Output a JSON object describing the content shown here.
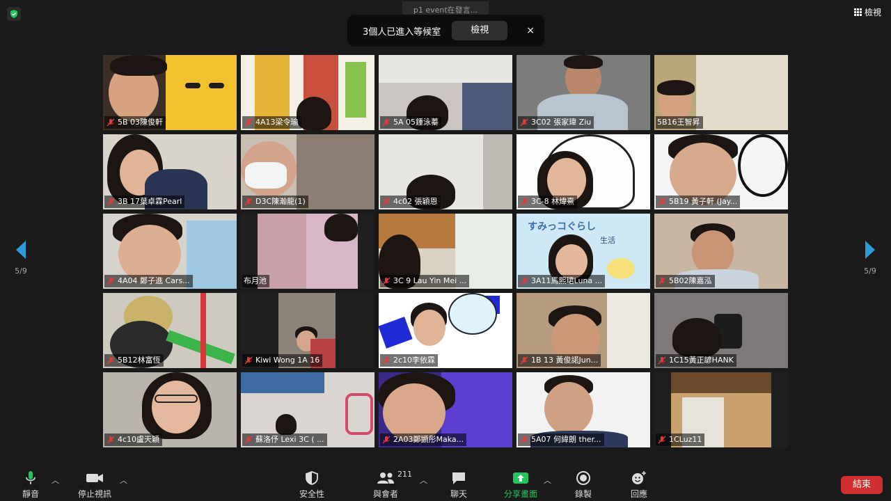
{
  "top": {
    "speaking_label": "p1 event在發言...",
    "view_label": "檢視"
  },
  "waiting_room": {
    "message": "3個人已進入等候室",
    "view_button": "檢視",
    "close_glyph": "×"
  },
  "pager": {
    "left_page": "5/9",
    "right_page": "5/9"
  },
  "participants": [
    "5B 03陳俊軒",
    "4A13梁令瑜",
    "5A 05鍾泳蓁",
    "3C02 張家瑋 Ziu",
    "5B16王智昇",
    "3B 17葉卓霖Pearl",
    "D3C陳瀚龍(1)",
    "4c02 張穎恩",
    "3C-8 林煒熹",
    "5B19 黃子軒 (Jay...",
    "4A04 鄭子進 Cars...",
    "布月池",
    "3C 9 Lau Yin Mei ...",
    "3A11馬熙珺Luna ...",
    "5B02陳嘉泓",
    "5B12林富恆",
    "Kiwi Wong 1A 16",
    "2c10李依霖",
    "1B  13  黃俊諾Jun...",
    "1C15黃正諺HANK",
    "4c10盧天穎",
    "蘇洛伃 Lexi  3C  ( ...",
    "2A03鄭顗彤Maka...",
    "5A07 何緯朗 ther...",
    "1CLuz11"
  ],
  "tile_art": {
    "sumikko_line1": "すみっコぐらし",
    "sumikko_line2": "生活"
  },
  "toolbar": {
    "mute": "靜音",
    "stop_video": "停止視訊",
    "security": "安全性",
    "participants": "與會者",
    "participant_count": "211",
    "chat": "聊天",
    "share_screen": "分享畫面",
    "record": "錄製",
    "reactions": "回應",
    "end": "結束"
  },
  "colors": {
    "accent_green": "#22c55e",
    "end_red": "#d12f2f",
    "mute_red": "#e03a3a",
    "nav_blue": "#2d9cdb"
  }
}
